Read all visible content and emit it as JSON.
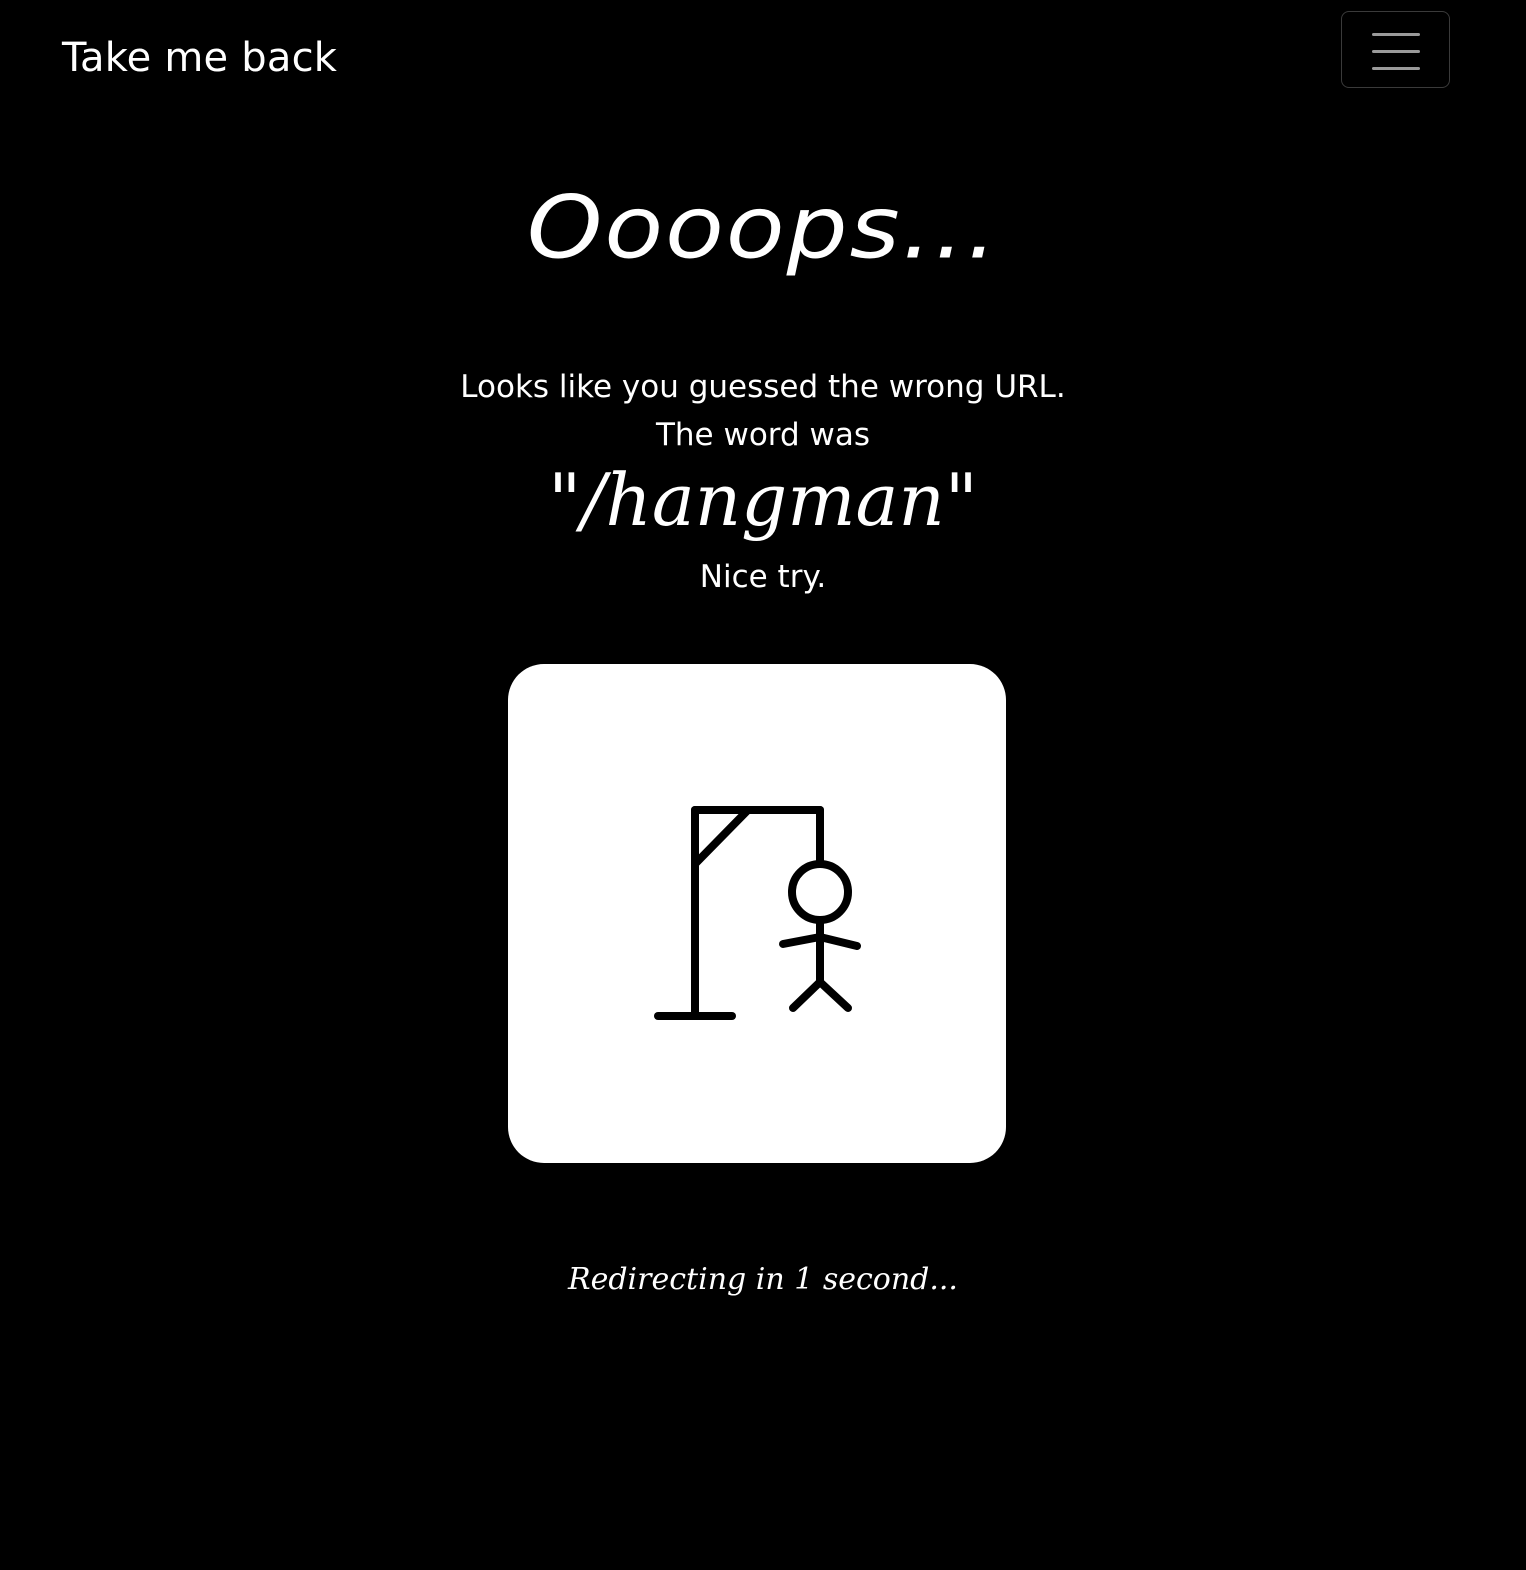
{
  "nav": {
    "brand_label": "Take me back",
    "menu_icon": "hamburger-menu-icon"
  },
  "main": {
    "title": "Oooops...",
    "line1": "Looks like you guessed the wrong URL.",
    "line2": "The word was",
    "word": "\"/hangman\"",
    "line3": "Nice try.",
    "illustration_icon": "hangman-icon",
    "redirect_text": "Redirecting in 1 second..."
  },
  "colors": {
    "background": "#000000",
    "text": "#ffffff",
    "card": "#ffffff",
    "drawing": "#000000"
  }
}
